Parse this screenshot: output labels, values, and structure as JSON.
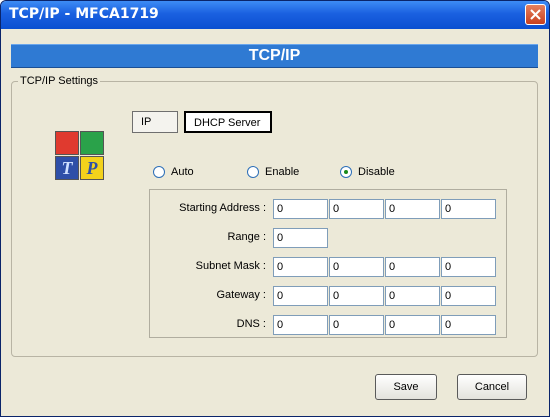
{
  "window": {
    "title": "TCP/IP - MFCA1719"
  },
  "header": {
    "title": "TCP/IP"
  },
  "group": {
    "label": "TCP/IP Settings"
  },
  "tabs": [
    {
      "label": "IP"
    },
    {
      "label": "DHCP Server",
      "active": true
    }
  ],
  "mode": {
    "options": [
      "Auto",
      "Enable",
      "Disable"
    ],
    "selected": "Disable"
  },
  "fields": {
    "starting_address": {
      "label": "Starting Address :",
      "values": [
        "0",
        "0",
        "0",
        "0"
      ]
    },
    "range": {
      "label": "Range :",
      "values": [
        "0"
      ]
    },
    "subnet_mask": {
      "label": "Subnet Mask :",
      "values": [
        "0",
        "0",
        "0",
        "0"
      ]
    },
    "gateway": {
      "label": "Gateway :",
      "values": [
        "0",
        "0",
        "0",
        "0"
      ]
    },
    "dns": {
      "label": "DNS :",
      "values": [
        "0",
        "0",
        "0",
        "0"
      ]
    }
  },
  "buttons": {
    "save": "Save",
    "cancel": "Cancel"
  },
  "logo": {
    "letters": [
      "T",
      "P"
    ],
    "colors": {
      "red": "#e03a2f",
      "green": "#2aa24a",
      "blue": "#2e4fa8",
      "yellow": "#f3d21c"
    }
  },
  "theme": {
    "accent": "#2f7ad3",
    "titlebar": "#0a4fd1"
  }
}
